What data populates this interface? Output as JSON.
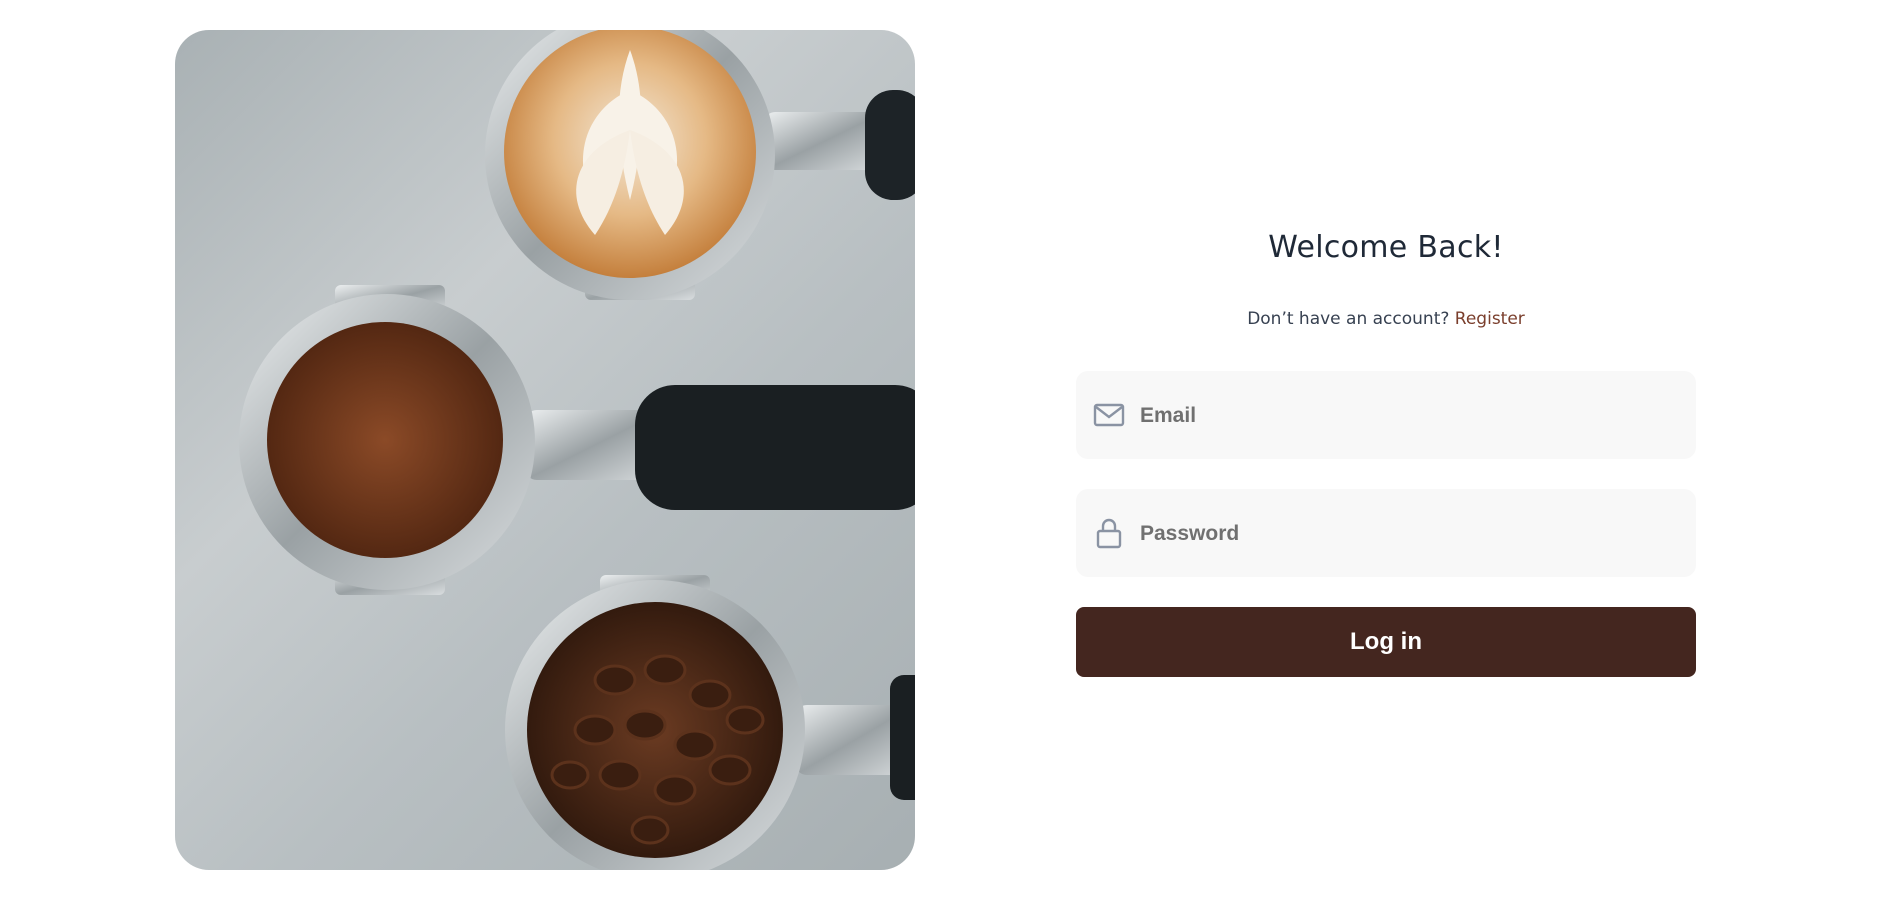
{
  "hero": {
    "image_alt": "Espresso portafilters with latte art, ground coffee and coffee beans"
  },
  "login": {
    "title": "Welcome Back!",
    "no_account_text": "Don’t have an account?",
    "register_link": "Register",
    "email": {
      "placeholder": "Email",
      "value": "",
      "icon": "mail-icon"
    },
    "password": {
      "placeholder": "Password",
      "value": "",
      "icon": "lock-icon"
    },
    "submit_label": "Log in"
  },
  "colors": {
    "accent": "#44261f",
    "link": "#7a3e2c",
    "field_bg": "#f8f8f8"
  }
}
